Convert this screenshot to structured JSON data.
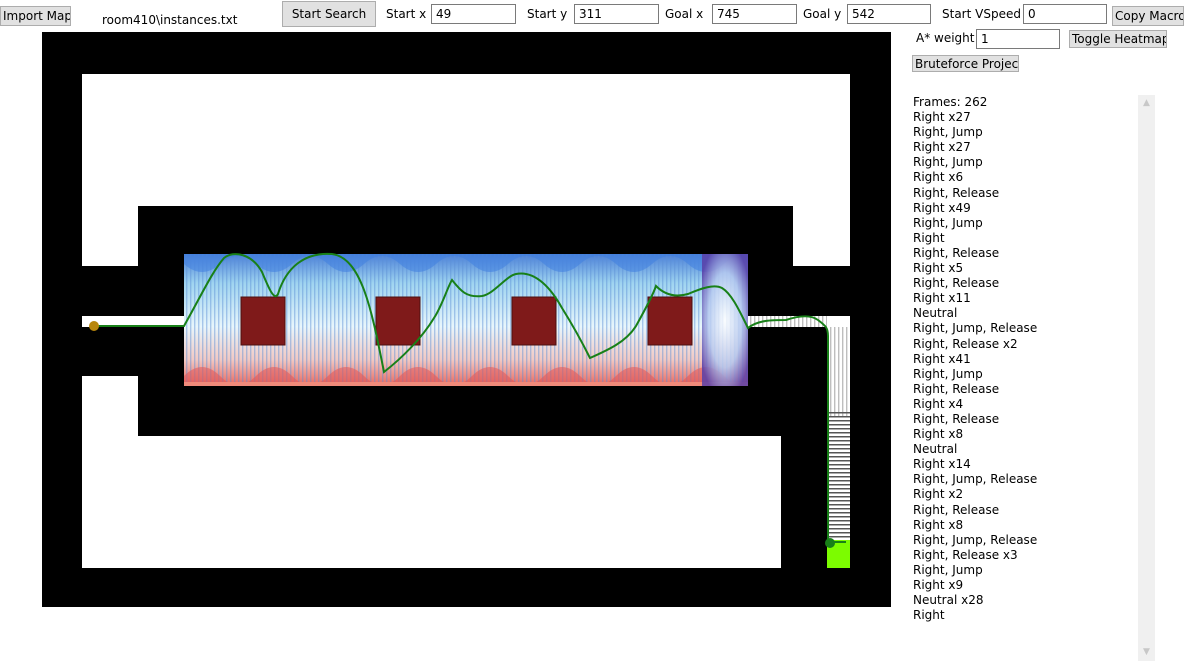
{
  "toolbar": {
    "import_label": "Import Map",
    "filename": "room410\\instances.txt",
    "start_search_label": "Start Search",
    "start_x_label": "Start x",
    "start_x_value": "49",
    "start_y_label": "Start y",
    "start_y_value": "311",
    "goal_x_label": "Goal x",
    "goal_x_value": "745",
    "goal_y_label": "Goal y",
    "goal_y_value": "542",
    "start_vspeed_label": "Start VSpeed",
    "start_vspeed_value": "0",
    "copy_macro_label": "Copy Macro",
    "astar_weight_label": "A* weight",
    "astar_weight_value": "1",
    "toggle_heatmap_label": "Toggle Heatmap",
    "bruteforce_label": "Bruteforce Project"
  },
  "macro": {
    "items": [
      "Frames: 262",
      "Right x27",
      "Right, Jump",
      "Right x27",
      "Right, Jump",
      "Right x6",
      "Right, Release",
      "Right x49",
      "Right, Jump",
      "Right",
      "Right, Release",
      "Right x5",
      "Right, Release",
      "Right x11",
      "Neutral",
      "Right, Jump, Release",
      "Right, Release x2",
      "Right x41",
      "Right, Jump",
      "Right, Release",
      "Right x4",
      "Right, Release",
      "Right x8",
      "Neutral",
      "Right x14",
      "Right, Jump, Release",
      "Right x2",
      "Right, Release",
      "Right x8",
      "Right, Jump, Release",
      "Right, Release x3",
      "Right, Jump",
      "Right x9",
      "Neutral x28",
      "Right"
    ]
  },
  "colors": {
    "wall": "#000000",
    "floor": "#ffffff",
    "block": "#7f1a1a",
    "path": "#188018",
    "start_marker": "#b8860b",
    "goal_marker": "#7cfc00"
  }
}
